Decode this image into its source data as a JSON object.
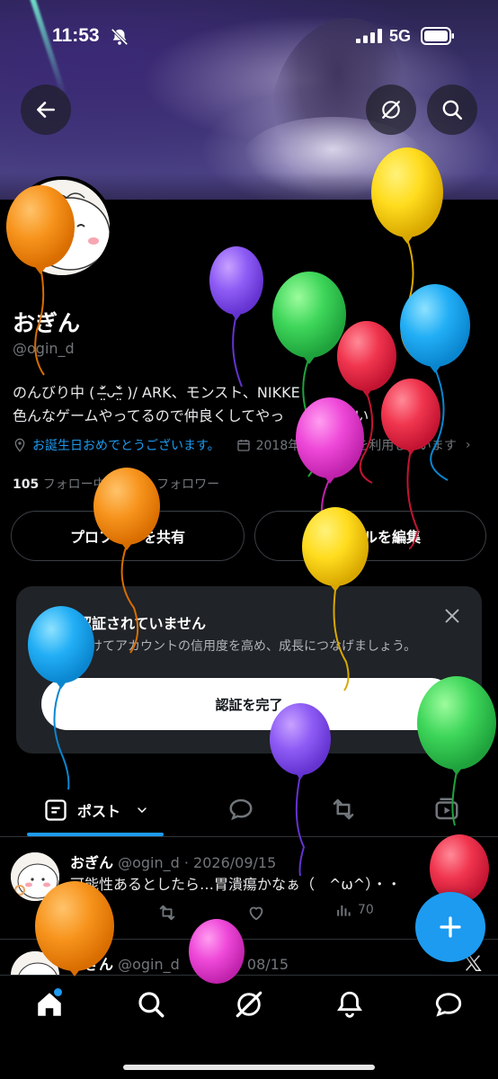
{
  "status_bar": {
    "time": "11:53",
    "network": "5G"
  },
  "profile": {
    "name": "おぎん",
    "handle": "@ogin_d",
    "bio_line1": "のんびり中 ( ˃̶̤᷄ᴗ˂̶̤᷅ )/ ARK、モンスト、NIKKE",
    "bio_line2": "色んなゲームやってるので仲良くしてやっ",
    "bio_line2_tail": "さい",
    "birthday": "お誕生日おめでとうございます。",
    "joined": "2018年",
    "joined_tail": "を利用しています",
    "following_count": "105",
    "following_label": "フォロー中",
    "followers_tail": "フォロワー"
  },
  "buttons": {
    "share_profile": "プロフ　　を共有",
    "edit_profile": "　　ールを編集"
  },
  "verify_card": {
    "title": "認証されていません",
    "desc": "受けてアカウントの信用度を高め、成長につなげましょう。",
    "cta": "認証を完了"
  },
  "tabs": {
    "posts": "ポスト"
  },
  "tweets": [
    {
      "name": "おぎん",
      "meta": "@ogin_d · 2026/09/15",
      "text": "可能性あるとしたら…胃潰瘍かなぁ（　^ω^）・・",
      "views": "70"
    },
    {
      "name": "おぎん",
      "meta": "@ogin_d",
      "date_tail": "08/15"
    }
  ],
  "colors": {
    "accent": "#1d9bf0",
    "background": "#000000",
    "card": "#202327",
    "muted_text": "#71767b"
  },
  "icons": [
    "back-arrow-icon",
    "grok-icon",
    "search-icon",
    "location-icon",
    "calendar-icon",
    "close-icon",
    "posts-tab-icon",
    "reply-icon",
    "repost-icon",
    "media-icon",
    "like-icon",
    "views-icon",
    "plus-icon",
    "home-icon",
    "notifications-icon",
    "messages-icon",
    "x-logo-icon"
  ]
}
